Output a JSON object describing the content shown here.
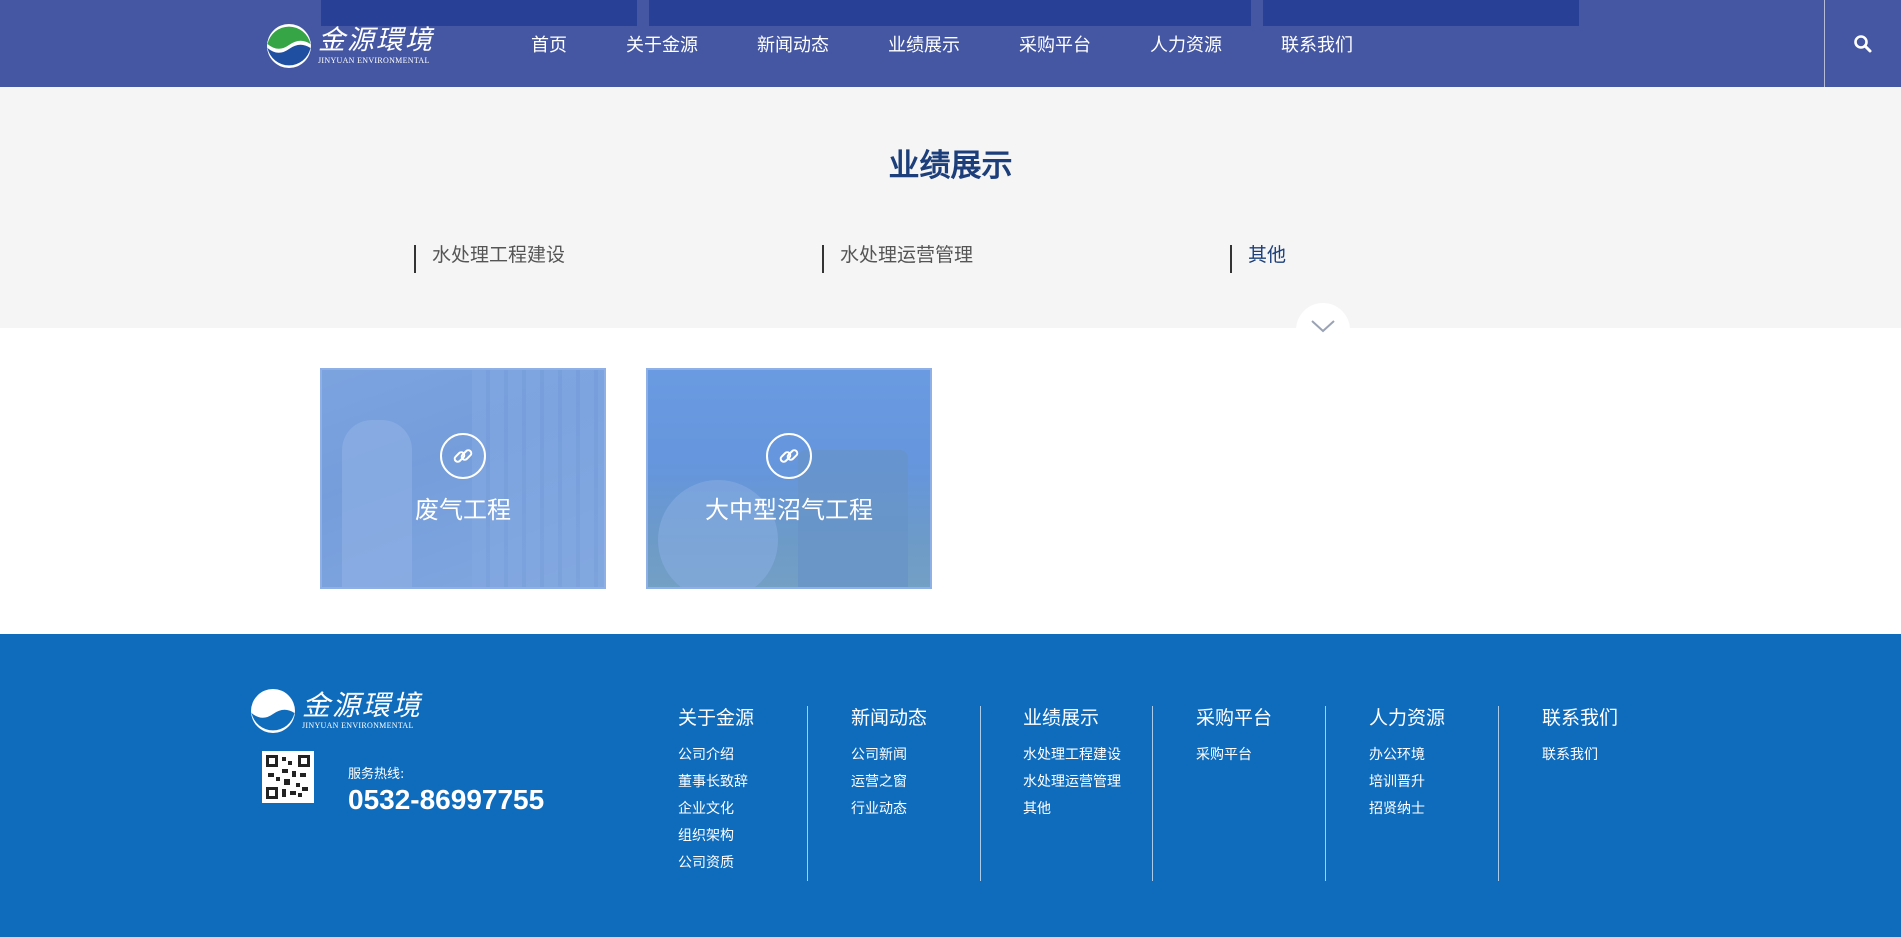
{
  "header": {
    "logo_cn": "金源環境",
    "logo_en": "JINYUAN ENVIRONMENTAL",
    "nav": [
      "首页",
      "关于金源",
      "新闻动态",
      "业绩展示",
      "采购平台",
      "人力资源",
      "联系我们"
    ]
  },
  "category": {
    "title": "业绩展示",
    "items": [
      "水处理工程建设",
      "水处理运营管理",
      "其他"
    ],
    "active_index": 2
  },
  "projects": [
    {
      "title": "废气工程",
      "icon": "link-icon"
    },
    {
      "title": "大中型沼气工程",
      "icon": "link-icon"
    }
  ],
  "footer": {
    "logo_cn": "金源環境",
    "logo_en": "JINYUAN ENVIRONMENTAL",
    "hotline_label": "服务热线:",
    "hotline": "0532-86997755",
    "columns": [
      {
        "title": "关于金源",
        "links": [
          "公司介绍",
          "董事长致辞",
          "企业文化",
          "组织架构",
          "公司资质"
        ]
      },
      {
        "title": "新闻动态",
        "links": [
          "公司新闻",
          "运营之窗",
          "行业动态"
        ]
      },
      {
        "title": "业绩展示",
        "links": [
          "水处理工程建设",
          "水处理运营管理",
          "其他"
        ]
      },
      {
        "title": "采购平台",
        "links": [
          "采购平台"
        ]
      },
      {
        "title": "人力资源",
        "links": [
          "办公环境",
          "培训晋升",
          "招贤纳士"
        ]
      },
      {
        "title": "联系我们",
        "links": [
          "联系我们"
        ]
      }
    ]
  },
  "colors": {
    "header_bg": "#4557a3",
    "title_blue": "#1c3f7b",
    "footer_bg": "#0f6cbd",
    "card_overlay": "#588cdc"
  }
}
